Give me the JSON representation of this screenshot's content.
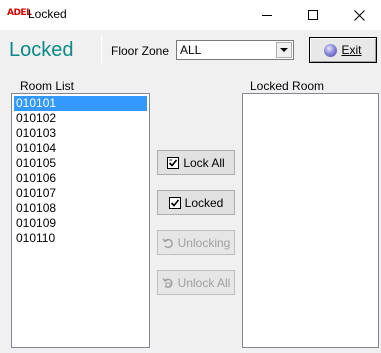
{
  "window": {
    "icon_text": "ADEL",
    "title": "Locked"
  },
  "header": {
    "heading": "Locked",
    "floor_zone_label": "Floor Zone",
    "floor_zone_value": "ALL",
    "exit_label": "Exit"
  },
  "room_list": {
    "label": "Room List",
    "items": [
      "010101",
      "010102",
      "010103",
      "010104",
      "010105",
      "010106",
      "010107",
      "010108",
      "010109",
      "010110"
    ],
    "selected_index": 0
  },
  "locked_room": {
    "label": "Locked Room",
    "items": []
  },
  "actions": {
    "lock_all": "Lock All",
    "locked": "Locked",
    "unlocking": "Unlocking",
    "unlock_all": "Unlock All"
  },
  "colors": {
    "heading": "#0a8a86",
    "selection": "#3399ff",
    "disabled_text": "#a0a0a0"
  }
}
